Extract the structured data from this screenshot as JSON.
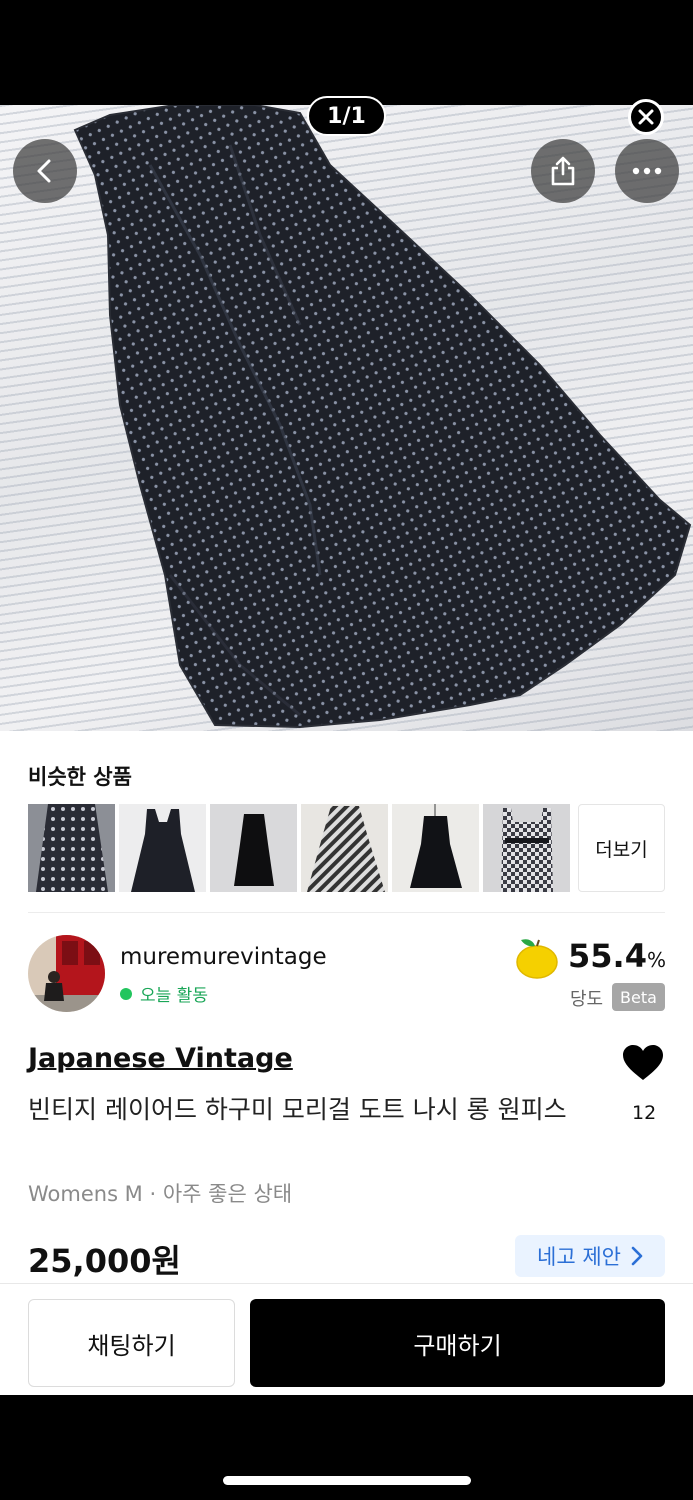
{
  "gallery": {
    "counter": "1/1",
    "page_dots": 6,
    "active_dot": 0
  },
  "icons": {
    "back": "chevron-left-icon",
    "share": "share-icon",
    "more": "more-horizontal-icon",
    "close": "close-icon"
  },
  "similar": {
    "title": "비슷한 상품",
    "more_label": "더보기",
    "thumbnail_count": 6
  },
  "seller": {
    "name": "muremurevintage",
    "activity": "오늘 활동",
    "sweetness_value": "55.4",
    "sweetness_unit": "%",
    "sweetness_label": "당도",
    "beta_badge": "Beta"
  },
  "product": {
    "brand": "Japanese Vintage",
    "title": "빈티지 레이어드 하구미 모리걸 도트 나시 롱 원피스",
    "likes": "12",
    "meta": "Womens M · 아주 좋은 상태",
    "price": "25,000원",
    "negotiate_label": "네고 제안"
  },
  "actions": {
    "chat_label": "채팅하기",
    "buy_label": "구매하기"
  },
  "colors": {
    "activity_green": "#22c55e",
    "nego_blue": "#2b6fd6",
    "nego_bg": "#eaf3ff"
  }
}
